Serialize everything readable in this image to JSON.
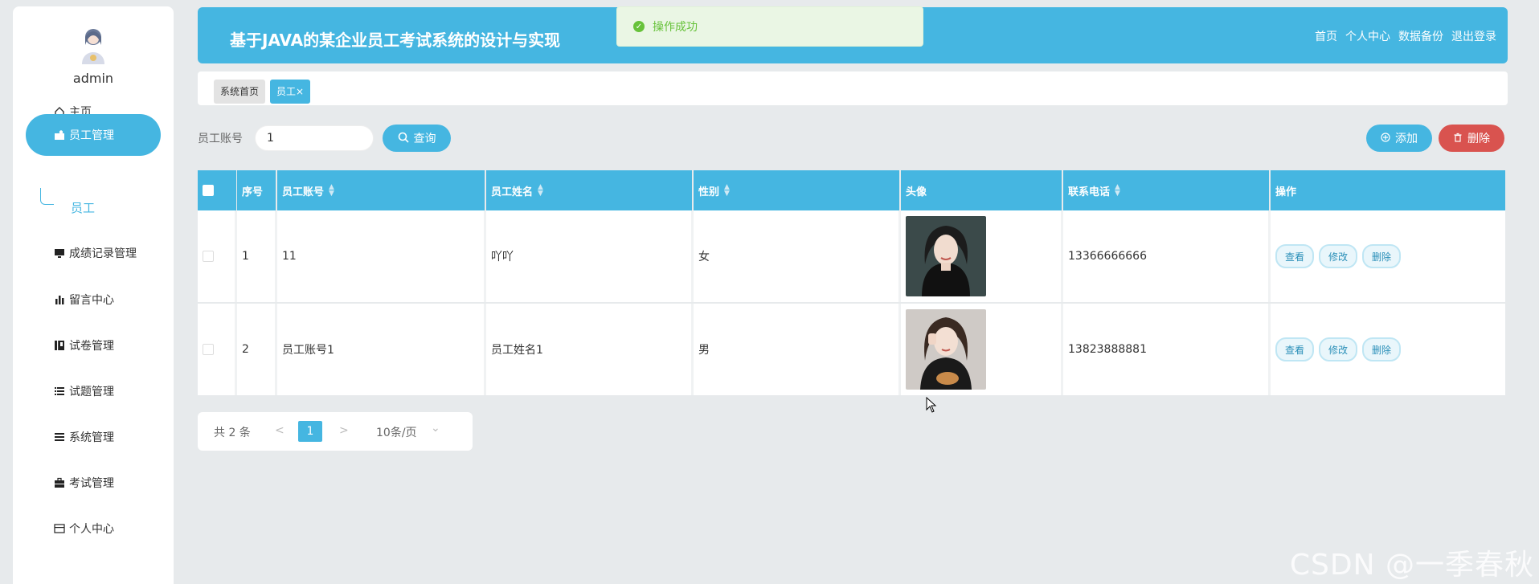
{
  "sidebar": {
    "username": "admin",
    "items": [
      {
        "label": "主页",
        "icon": "home-icon"
      },
      {
        "label": "员工管理",
        "icon": "folder-user-icon"
      },
      {
        "label": "成绩记录管理",
        "icon": "monitor-icon"
      },
      {
        "label": "留言中心",
        "icon": "bar-chart-icon"
      },
      {
        "label": "试卷管理",
        "icon": "book-icon"
      },
      {
        "label": "试题管理",
        "icon": "list-icon"
      },
      {
        "label": "系统管理",
        "icon": "menu-icon"
      },
      {
        "label": "考试管理",
        "icon": "briefcase-icon"
      },
      {
        "label": "个人中心",
        "icon": "card-icon"
      }
    ],
    "sub_item": "员工"
  },
  "header": {
    "title": "基于JAVA的某企业员工考试系统的设计与实现",
    "links": [
      "首页",
      "个人中心",
      "数据备份",
      "退出登录"
    ]
  },
  "toast": {
    "text": "操作成功"
  },
  "tabs": {
    "home": "系统首页",
    "current": "员工",
    "close": "×"
  },
  "search": {
    "label": "员工账号",
    "value": "1",
    "button": "查询"
  },
  "actions": {
    "add": "添加",
    "delete": "删除"
  },
  "table": {
    "headers": [
      "序号",
      "员工账号",
      "员工姓名",
      "性别",
      "头像",
      "联系电话",
      "操作"
    ],
    "rows": [
      {
        "index": "1",
        "account": "11",
        "name": "吖吖",
        "gender": "女",
        "phone": "13366666666"
      },
      {
        "index": "2",
        "account": "员工账号1",
        "name": "员工姓名1",
        "gender": "男",
        "phone": "13823888881"
      }
    ],
    "row_buttons": {
      "view": "查看",
      "edit": "修改",
      "delete": "删除"
    }
  },
  "pagination": {
    "total": "共 2 条",
    "prev": "<",
    "page": "1",
    "next": ">",
    "page_size": "10条/页",
    "dropdown": "⌄"
  },
  "watermark": "CSDN @一季春秋",
  "colors": {
    "primary": "#45b6e1",
    "danger": "#d9534f",
    "success": "#67c23a"
  }
}
